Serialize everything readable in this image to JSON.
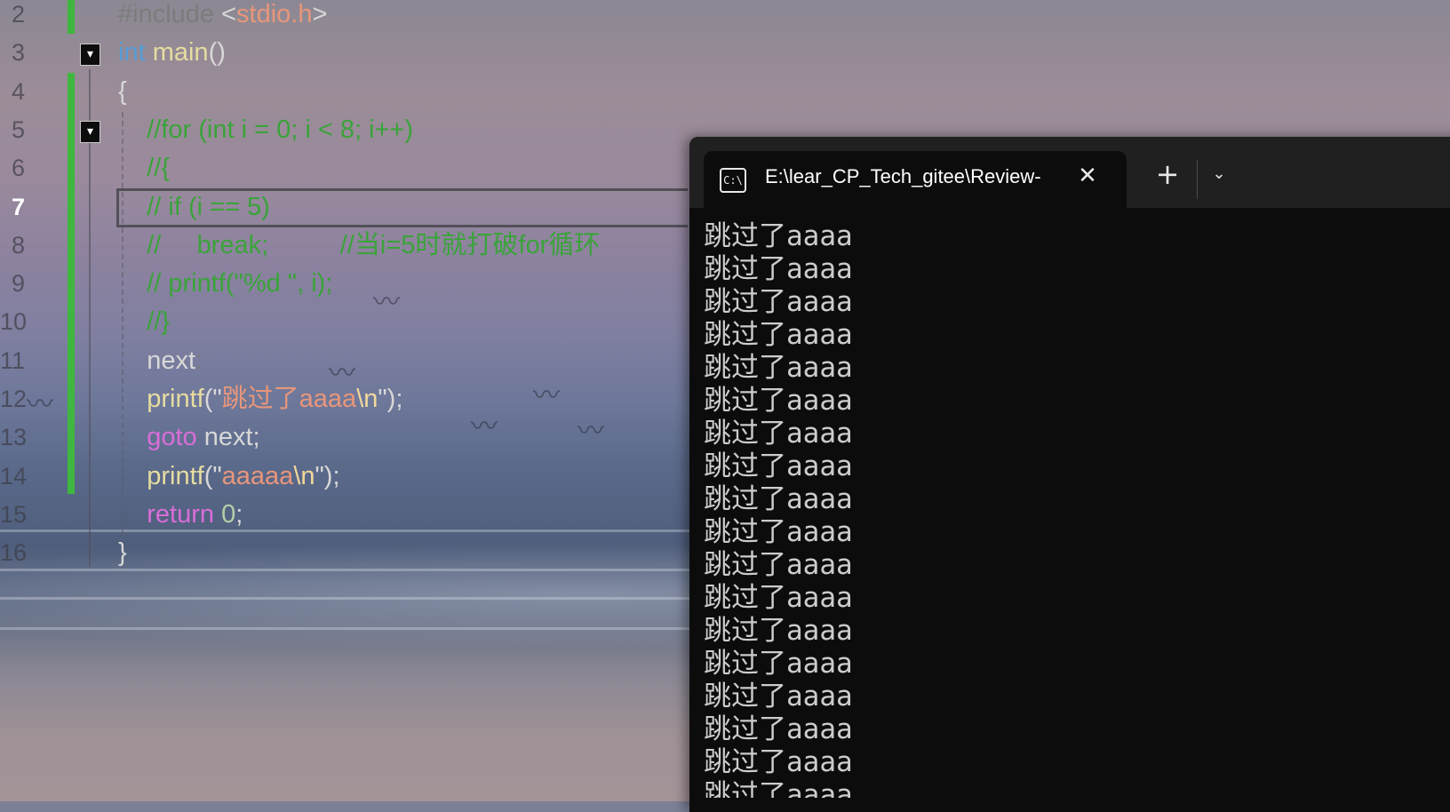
{
  "editor": {
    "lines": [
      {
        "num": "2",
        "tokens": [
          {
            "t": "#include ",
            "c": "pre"
          },
          {
            "t": "<",
            "c": "punct"
          },
          {
            "t": "stdio.h",
            "c": "str"
          },
          {
            "t": ">",
            "c": "punct"
          }
        ]
      },
      {
        "num": "3",
        "tokens": [
          {
            "t": "int",
            "c": "kw-blue"
          },
          {
            "t": " ",
            "c": "punct"
          },
          {
            "t": "main",
            "c": "fn"
          },
          {
            "t": "()",
            "c": "punct"
          }
        ]
      },
      {
        "num": "4",
        "tokens": [
          {
            "t": "{",
            "c": "punct"
          }
        ]
      },
      {
        "num": "5",
        "tokens": [
          {
            "t": "    //for (int i = 0; i < 8; i++)",
            "c": "cmt"
          }
        ]
      },
      {
        "num": "6",
        "tokens": [
          {
            "t": "    //{",
            "c": "cmt"
          }
        ]
      },
      {
        "num": "7",
        "tokens": [
          {
            "t": "    // if (i == 5)",
            "c": "cmt"
          }
        ]
      },
      {
        "num": "8",
        "tokens": [
          {
            "t": "    //     break;          //当i=5时就打破for循环",
            "c": "cmt"
          }
        ]
      },
      {
        "num": "9",
        "tokens": [
          {
            "t": "    // printf(\"%d \", i);",
            "c": "cmt"
          }
        ]
      },
      {
        "num": "10",
        "tokens": [
          {
            "t": "    //}",
            "c": "cmt"
          }
        ]
      },
      {
        "num": "11",
        "tokens": [
          {
            "t": "    next",
            "c": "punct"
          },
          {
            "t": ":",
            "c": "pre"
          }
        ]
      },
      {
        "num": "12",
        "tokens": [
          {
            "t": "    ",
            "c": "punct"
          },
          {
            "t": "printf",
            "c": "fn"
          },
          {
            "t": "(\"",
            "c": "punct"
          },
          {
            "t": "跳过了aaaa",
            "c": "str"
          },
          {
            "t": "\\n",
            "c": "esc"
          },
          {
            "t": "\");",
            "c": "punct"
          }
        ]
      },
      {
        "num": "13",
        "tokens": [
          {
            "t": "    ",
            "c": "punct"
          },
          {
            "t": "goto",
            "c": "kw-purple"
          },
          {
            "t": " next;",
            "c": "punct"
          }
        ]
      },
      {
        "num": "14",
        "tokens": [
          {
            "t": "    ",
            "c": "punct"
          },
          {
            "t": "printf",
            "c": "fn"
          },
          {
            "t": "(\"",
            "c": "punct"
          },
          {
            "t": "aaaaa",
            "c": "str"
          },
          {
            "t": "\\n",
            "c": "esc"
          },
          {
            "t": "\");",
            "c": "punct"
          }
        ]
      },
      {
        "num": "15",
        "tokens": [
          {
            "t": "    ",
            "c": "punct"
          },
          {
            "t": "return",
            "c": "kw-purple"
          },
          {
            "t": " ",
            "c": "punct"
          },
          {
            "t": "0",
            "c": "num"
          },
          {
            "t": ";",
            "c": "punct"
          }
        ]
      },
      {
        "num": "16",
        "tokens": [
          {
            "t": "}",
            "c": "punct"
          }
        ]
      }
    ],
    "active_line": "7"
  },
  "terminal": {
    "tab_title": "E:\\lear_CP_Tech_gitee\\Review-",
    "tab_icon": "C:\\",
    "close_icon": "✕",
    "new_tab_icon": "+",
    "dropdown_icon": "⌄",
    "output_text": "跳过了aaaa",
    "output_count": 19
  },
  "colors": {
    "terminal_bg": "#0c0c0c",
    "tab_bar_bg": "#202020",
    "gutter_change": "#3fb73f",
    "comment": "#3aa33a"
  }
}
